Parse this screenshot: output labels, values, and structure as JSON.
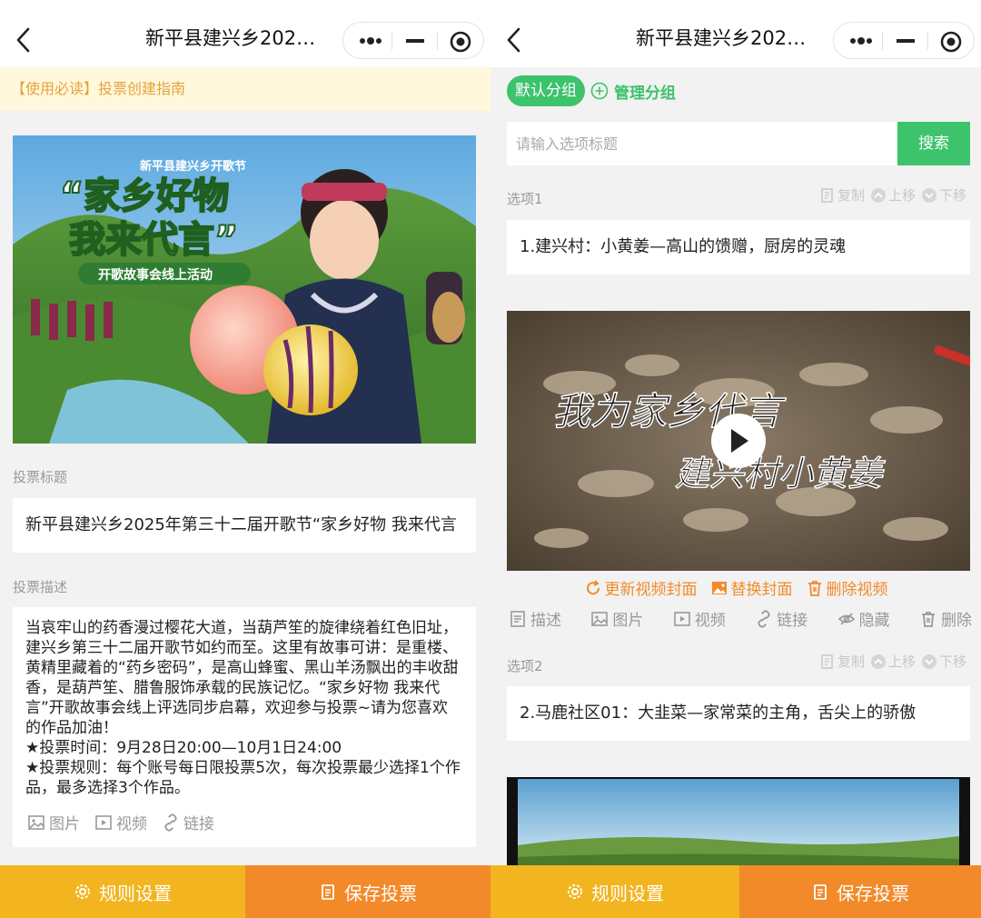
{
  "left": {
    "nav": {
      "title": "新平县建兴乡2025年..."
    },
    "notice": "【使用必读】投票创建指南",
    "cover": {
      "small_text": "新平县建兴乡开歌节",
      "headline1": "“家乡好物",
      "headline2": "我来代言”",
      "ribbon": "开歌故事会线上活动"
    },
    "title_label": "投票标题",
    "title_value": "新平县建兴乡2025年第三十二届开歌节“家乡好物  我来代言",
    "desc_label": "投票描述",
    "desc_value": "当哀牢山的药香漫过樱花大道，当葫芦笙的旋律绕着红色旧址，建兴乡第三十二届开歌节如约而至。这里有故事可讲：是重楼、黄精里藏着的“药乡密码”，是高山蜂蜜、黑山羊汤飘出的丰收甜香，是葫芦笙、腊鲁服饰承载的民族记忆。“家乡好物 我来代言”开歌故事会线上评选同步启幕，欢迎参与投票~请为您喜欢的作品加油！\n★投票时间：9月28日20:00—10月1日24:00\n★投票规则：每个账号每日限投票5次，每次投票最少选择1个作品，最多选择3个作品。",
    "tools": {
      "image": "图片",
      "video": "视频",
      "link": "链接"
    }
  },
  "right": {
    "nav": {
      "title": "新平县建兴乡2025年..."
    },
    "group_tag": "默认分组",
    "manage_group": "管理分组",
    "search": {
      "placeholder": "请输入选项标题",
      "button": "搜索"
    },
    "option_actions": {
      "copy": "复制",
      "up": "上移",
      "down": "下移"
    },
    "options": [
      {
        "label": "选项1",
        "title": "1.建兴村：小黄姜—高山的馈赠，厨房的灵魂",
        "video_caption1": "我为家乡代言",
        "video_caption2": "建兴村小黄姜"
      },
      {
        "label": "选项2",
        "title": "2.马鹿社区01：大韭菜—家常菜的主角，舌尖上的骄傲"
      }
    ],
    "video_actions": {
      "update_cover": "更新视频封面",
      "replace_cover": "替换封面",
      "delete_video": "删除视频"
    },
    "option_tools": {
      "describe": "描述",
      "image": "图片",
      "video": "视频",
      "link": "链接",
      "hide": "隐藏",
      "delete": "删除"
    }
  },
  "bottom": {
    "rules": "规则设置",
    "save": "保存投票"
  },
  "colors": {
    "green": "#3cc36b",
    "orange": "#f28a2a",
    "yellow": "#f2b51f",
    "notice_text": "#e6a23c"
  }
}
